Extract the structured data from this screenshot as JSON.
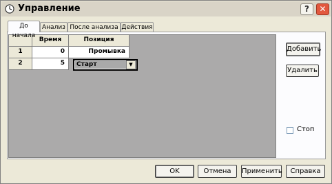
{
  "window": {
    "title": "Управление",
    "help_glyph": "?",
    "close_glyph": "✕"
  },
  "tabs": [
    {
      "label": "До начала",
      "active": true
    },
    {
      "label": "Анализ",
      "active": false
    },
    {
      "label": "После анализа",
      "active": false
    },
    {
      "label": "Действия",
      "active": false
    }
  ],
  "table": {
    "headers": [
      "",
      "Время",
      "Позиция"
    ],
    "rows": [
      {
        "num": "1",
        "time": "0",
        "position": "Промывка"
      },
      {
        "num": "2",
        "time": "5",
        "position": "Старт"
      }
    ]
  },
  "editor": {
    "dropdown_arrow": "▼"
  },
  "side": {
    "add": "Добавить",
    "delete": "Удалить",
    "stop_label": "Стоп",
    "stop_checked": false
  },
  "buttons": {
    "ok": "OK",
    "cancel": "Отмена",
    "apply": "Применить",
    "help": "Справка"
  },
  "colors": {
    "grid_background": "#abaaaa",
    "close_button": "#e2583e",
    "panel": "#fcfcfe",
    "window": "#ece9d8"
  }
}
